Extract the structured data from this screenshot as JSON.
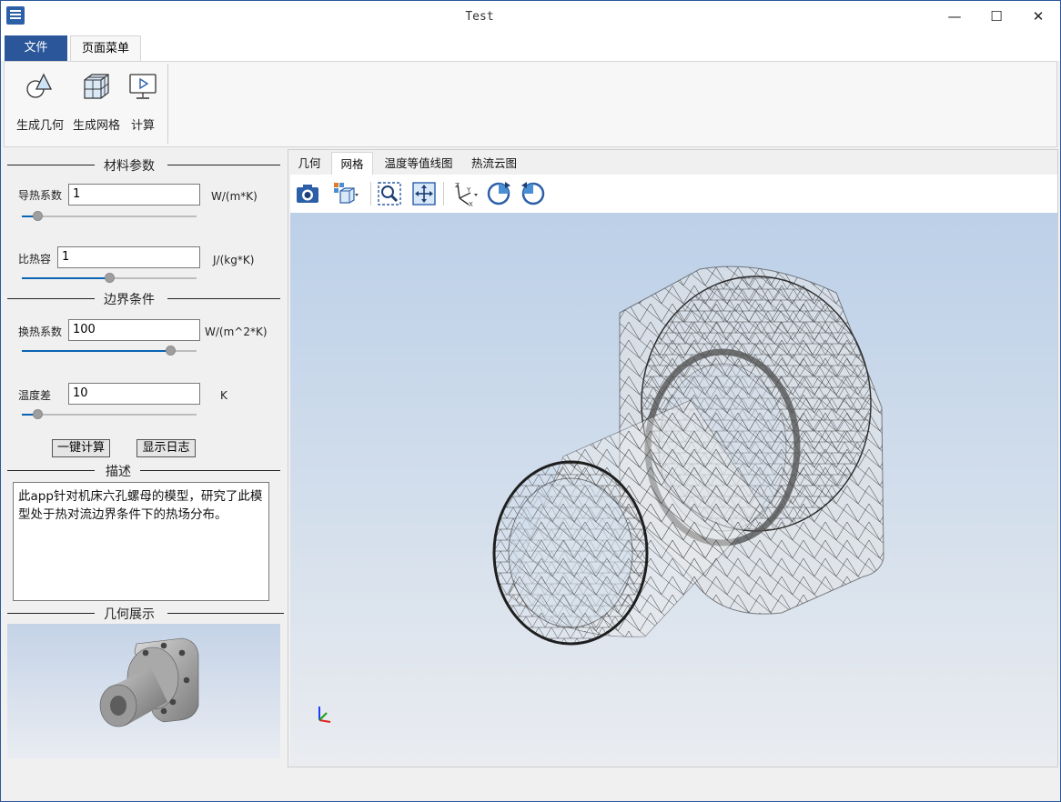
{
  "window": {
    "title": "Test",
    "buttons": {
      "minimize": "—",
      "maximize": "☐",
      "close": "✕"
    }
  },
  "ribbon": {
    "tabs": [
      {
        "label": "文件",
        "active": false
      },
      {
        "label": "页面菜单",
        "active": true
      }
    ],
    "buttons": [
      {
        "label": "生成几何",
        "icon": "geometry-shapes-icon"
      },
      {
        "label": "生成网格",
        "icon": "mesh-cube-icon"
      },
      {
        "label": "计算",
        "icon": "compute-monitor-icon"
      }
    ]
  },
  "left_panel": {
    "material_section": "材料参数",
    "boundary_section": "边界条件",
    "description_section": "描述",
    "geometry_section": "几何展示",
    "params": [
      {
        "label": "导热系数",
        "value": "1",
        "unit": "W/(m*K)",
        "slider_fraction": 0.09
      },
      {
        "label": "比热容",
        "value": "1",
        "unit": "J/(kg*K)",
        "slider_fraction": 0.5
      },
      {
        "label": "换热系数",
        "value": "100",
        "unit": "W/(m^2*K)",
        "slider_fraction": 0.85
      },
      {
        "label": "温度差",
        "value": "10",
        "unit": "K",
        "slider_fraction": 0.09
      }
    ],
    "compute_button": "一键计算",
    "log_button": "显示日志",
    "description": "此app针对机床六孔螺母的模型，研究了此模型处于热对流边界条件下的热场分布。"
  },
  "view_tabs": [
    {
      "label": "几何",
      "active": false
    },
    {
      "label": "网格",
      "active": true
    },
    {
      "label": "温度等值线图",
      "active": false
    },
    {
      "label": "热流云图",
      "active": false
    }
  ],
  "view_toolbar": [
    "camera-icon",
    "view-cube-dropdown-icon",
    "zoom-box-icon",
    "fit-all-icon",
    "axis-orientation-dropdown-icon",
    "rotate-ccw-icon",
    "rotate-cw-icon"
  ],
  "colors": {
    "accent": "#2b579a",
    "viewport_top": "#bcd0e8",
    "viewport_bottom": "#eaecf0"
  }
}
